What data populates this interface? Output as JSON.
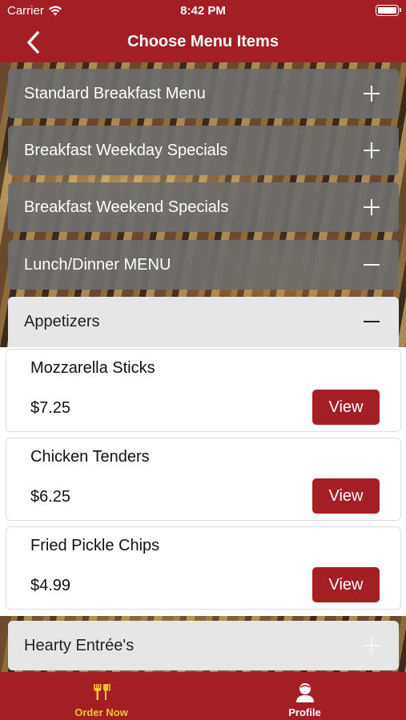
{
  "status_bar": {
    "carrier": "Carrier",
    "time": "8:42 PM"
  },
  "header": {
    "title": "Choose Menu Items",
    "back_icon": "chevron-left-icon"
  },
  "menus": [
    {
      "label": "Standard Breakfast Menu",
      "expanded": false
    },
    {
      "label": "Breakfast Weekday Specials",
      "expanded": false
    },
    {
      "label": "Breakfast Weekend Specials",
      "expanded": false
    },
    {
      "label": "Lunch/Dinner MENU",
      "expanded": true
    }
  ],
  "subcategory": {
    "label": "Appetizers",
    "expanded": true
  },
  "items": [
    {
      "name": "Mozzarella Sticks",
      "price": "$7.25",
      "button": "View"
    },
    {
      "name": "Chicken Tenders",
      "price": "$6.25",
      "button": "View"
    },
    {
      "name": "Fried Pickle Chips",
      "price": "$4.99",
      "button": "View"
    }
  ],
  "next_subcategory": {
    "label": "Hearty Entrée's",
    "expanded": false
  },
  "tabbar": {
    "order_now": {
      "label": "Order Now",
      "icon": "utensils-icon",
      "active": true
    },
    "profile": {
      "label": "Profile",
      "icon": "user-icon",
      "active": false
    }
  },
  "colors": {
    "brand": "#a31f24",
    "active_tab": "#f4c430",
    "row_dark": "#6c6c6c",
    "row_light": "#e6e6e6"
  }
}
